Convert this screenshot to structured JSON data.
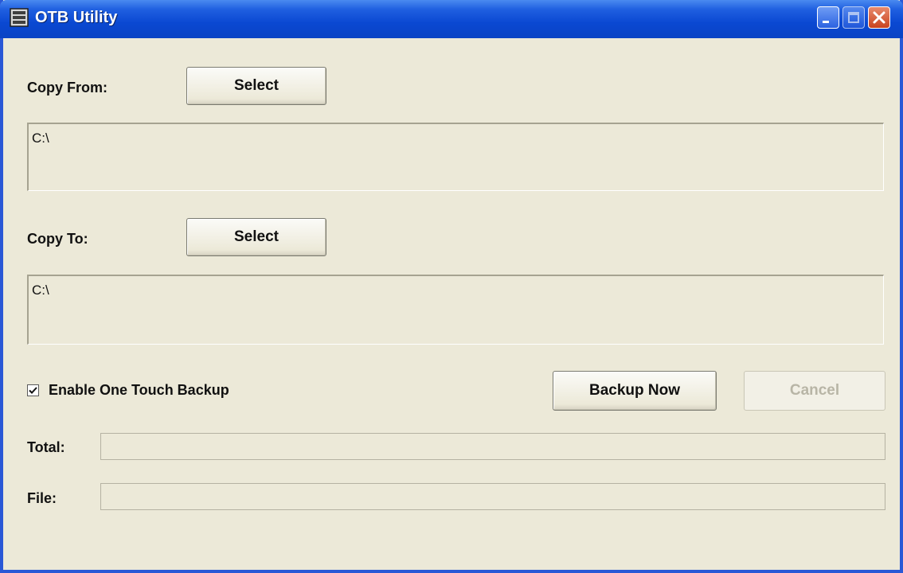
{
  "window": {
    "title": "OTB Utility"
  },
  "copy_from": {
    "label": "Copy From:",
    "select_label": "Select",
    "path": "C:\\"
  },
  "copy_to": {
    "label": "Copy To:",
    "select_label": "Select",
    "path": "C:\\"
  },
  "enable_backup": {
    "label": "Enable One Touch Backup",
    "checked": true
  },
  "actions": {
    "backup_now_label": "Backup Now",
    "cancel_label": "Cancel"
  },
  "progress": {
    "total_label": "Total:",
    "total_value": 0,
    "file_label": "File:",
    "file_value": 0
  },
  "colors": {
    "titlebar": "#0a48d2",
    "window_bg": "#ece9d8",
    "close_button": "#c9431e"
  }
}
